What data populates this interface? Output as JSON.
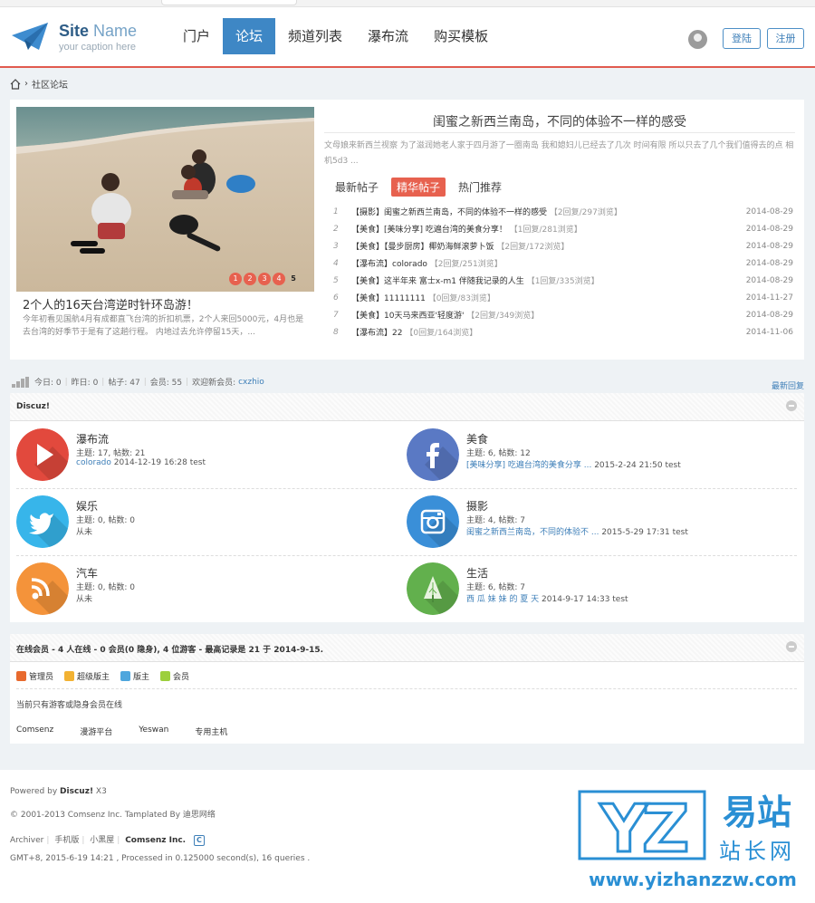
{
  "header": {
    "logo_name_bold": "Site",
    "logo_name_light": "Name",
    "logo_caption": "your caption here",
    "nav": [
      "门户",
      "论坛",
      "频道列表",
      "瀑布流",
      "购买模板"
    ],
    "active_nav": "论坛",
    "login_label": "登陆",
    "register_label": "注册"
  },
  "breadcrumb": {
    "current": "社区论坛"
  },
  "feature": {
    "slide_caption": "2个人的16天台湾逆时针环岛游！",
    "slide_desc": "今年初看见国航4月有成都直飞台湾的折扣机票，2个人来回5000元，4月也是去台湾的好季节于是有了这趟行程。 内地过去允许停留15天，...",
    "slide_dots": [
      "1",
      "2",
      "3",
      "4",
      "5"
    ],
    "article_title": "闺蜜之新西兰南岛，不同的体验不一样的感受",
    "article_desc": "文母娘来新西兰视察 为了滋润她老人家于四月游了一圈南岛 我和媳妇儿已经去了几次 时间有限 所以只去了几个我们值得去的点 相机5d3 ...",
    "tabs": [
      "最新帖子",
      "精华帖子",
      "热门推荐"
    ],
    "active_tab": "精华帖子",
    "posts": [
      {
        "num": "1",
        "cat": "【摄影】",
        "title": "闺蜜之新西兰南岛，不同的体验不一样的感受",
        "meta": "【2回复/297浏览】",
        "date": "2014-08-29"
      },
      {
        "num": "2",
        "cat": "【美食】",
        "title": "[美味分享] 吃遍台湾的美食分享！",
        "meta": "【1回复/281浏览】",
        "date": "2014-08-29"
      },
      {
        "num": "3",
        "cat": "【美食】",
        "title": "【曼步厨房】椰奶海鲜滚萝卜饭",
        "meta": "【2回复/172浏览】",
        "date": "2014-08-29"
      },
      {
        "num": "4",
        "cat": "【瀑布流】",
        "title": "colorado",
        "meta": "【2回复/251浏览】",
        "date": "2014-08-29"
      },
      {
        "num": "5",
        "cat": "【美食】",
        "title": "这半年来 富士x-m1 伴随我记录的人生",
        "meta": "【1回复/335浏览】",
        "date": "2014-08-29"
      },
      {
        "num": "6",
        "cat": "【美食】",
        "title": "11111111",
        "meta": "【0回复/83浏览】",
        "date": "2014-11-27"
      },
      {
        "num": "7",
        "cat": "【美食】",
        "title": "10天马来西亚'轻度游'",
        "meta": "【2回复/349浏览】",
        "date": "2014-08-29"
      },
      {
        "num": "8",
        "cat": "【瀑布流】",
        "title": "22",
        "meta": "【0回复/164浏览】",
        "date": "2014-11-06"
      }
    ]
  },
  "stats": {
    "today": "今日: 0",
    "yesterday": "昨日: 0",
    "posts": "帖子: 47",
    "members": "会员: 55",
    "welcome": "欢迎新会员:",
    "new_member": "cxzhio",
    "latest_reply": "最新回复"
  },
  "forum_group": {
    "title": "Discuz!",
    "forums": [
      {
        "name": "瀑布流",
        "stats": "主题: 17, 帖数: 21",
        "last_link": "colorado",
        "last_rest": "2014-12-19 16:28 test",
        "icon": "play-icon",
        "color": "#e2493d"
      },
      {
        "name": "美食",
        "stats": "主题: 6, 帖数: 12",
        "last_link": "[美味分享] 吃遍台湾的美食分享 ...",
        "last_rest": "2015-2-24 21:50 test",
        "icon": "facebook-icon",
        "color": "#5a79c4"
      },
      {
        "name": "娱乐",
        "stats": "主题: 0, 帖数: 0",
        "last_link": "",
        "last_rest": "从未",
        "icon": "twitter-icon",
        "color": "#37b5ea"
      },
      {
        "name": "摄影",
        "stats": "主题: 4, 帖数: 7",
        "last_link": "闺蜜之新西兰南岛，不同的体验不 ...",
        "last_rest": "2015-5-29 17:31 test",
        "icon": "camera-icon",
        "color": "#3a8fd8"
      },
      {
        "name": "汽车",
        "stats": "主题: 0, 帖数: 0",
        "last_link": "",
        "last_rest": "从未",
        "icon": "rss-icon",
        "color": "#f4933a"
      },
      {
        "name": "生活",
        "stats": "主题: 6, 帖数: 7",
        "last_link": "西 瓜 妹 妹 的 夏 天",
        "last_rest": "2014-9-17 14:33 test",
        "icon": "tree-icon",
        "color": "#62b04d"
      }
    ]
  },
  "online": {
    "title": "在线会员 - 4 人在线 - 0 会员(0 隐身), 4 位游客 - 最高记录是 21 于 2014-9-15.",
    "legend": [
      {
        "label": "管理员",
        "color": "#e86a2e"
      },
      {
        "label": "超级版主",
        "color": "#f2b233"
      },
      {
        "label": "版主",
        "color": "#4fa6dd"
      },
      {
        "label": "会员",
        "color": "#9ccf3d"
      }
    ],
    "note": "当前只有游客或隐身会员在线",
    "links": [
      "Comsenz",
      "漫游平台",
      "Yeswan",
      "专用主机"
    ]
  },
  "footer": {
    "powered_prefix": "Powered by",
    "powered_name": "Discuz!",
    "powered_ver": "X3",
    "copyright": "© 2001-2013 Comsenz Inc. Tamplated By 迪思网络",
    "links": [
      "Archiver",
      "手机版",
      "小黑屋"
    ],
    "company": "Comsenz Inc.",
    "gmt": "GMT+8, 2015-6-19 14:21 , Processed in 0.125000 second(s), 16 queries ."
  },
  "watermark": {
    "letters": "YZ",
    "cn_top": "易站",
    "cn_bottom": "站长网",
    "url": "www.yizhanzzw.com"
  }
}
